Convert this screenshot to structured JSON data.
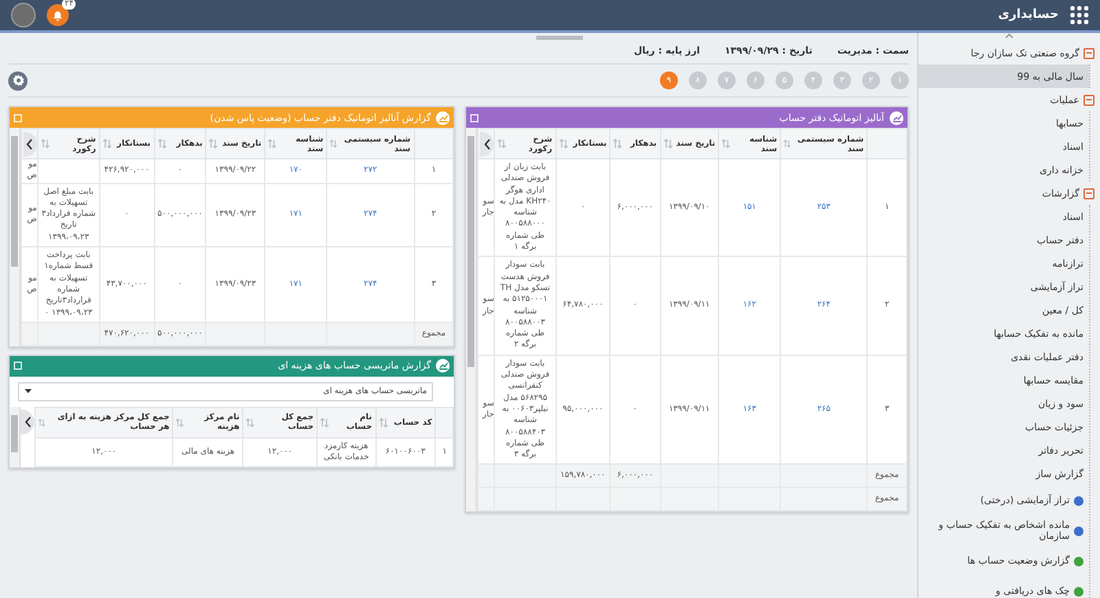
{
  "topbar": {
    "title": "حسابداری",
    "notifications": "۲۴"
  },
  "info": [
    "سمت : مدیریت",
    "تاریخ : ۱۳۹۹/۰۹/۲۹",
    "ارز پایه : ریال"
  ],
  "pager": [
    {
      "label": "۱",
      "selected": false
    },
    {
      "label": "۲",
      "selected": false
    },
    {
      "label": "۳",
      "selected": false
    },
    {
      "label": "۴",
      "selected": false
    },
    {
      "label": "۵",
      "selected": false
    },
    {
      "label": "۶",
      "selected": false
    },
    {
      "label": "۷",
      "selected": false
    },
    {
      "label": "۸",
      "selected": false
    },
    {
      "label": "۹",
      "selected": true
    }
  ],
  "panels": [
    {
      "kind": "ledger",
      "title": "آنالیز اتوماتیک دفتر حساب",
      "color": "#9b6bcc",
      "columns": [
        {
          "label": "شماره سیستمی سند",
          "kind": "link"
        },
        {
          "label": "شناسه سند",
          "kind": "link"
        },
        {
          "label": "تاریخ سند",
          "kind": "text"
        },
        {
          "label": "بدهکار",
          "kind": "text"
        },
        {
          "label": "بستانکار",
          "kind": "text"
        },
        {
          "label": "شرح رکورد",
          "kind": "text"
        }
      ],
      "rows": [
        {
          "index": "۱",
          "cells": [
            "۲۵۳",
            "۱۵۱",
            "۱۳۹۹/۰۹/۱۰",
            "۶,۰۰۰,۰۰۰",
            "۰",
            "بابت زیان از فروش صندلی اداری هوگر KH۲۴۰ مدل به شناسه ۸۰۰۵۸۸۰۰۰ طی شماره برگه ۱"
          ],
          "cut": "سو جار"
        },
        {
          "index": "۲",
          "cells": [
            "۲۶۴",
            "۱۶۲",
            "۱۳۹۹/۰۹/۱۱",
            "۰",
            "۶۴,۷۸۰,۰۰۰",
            "بابت سودار فروش هدست تسکو مدل TH ۵۱۲۵۰۰۰۱ به شناسه ۸۰۰۵۸۸۰۰۳ طی شماره برگه ۲"
          ],
          "cut": "سو جار"
        },
        {
          "index": "۳",
          "cells": [
            "۲۶۵",
            "۱۶۳",
            "۱۳۹۹/۰۹/۱۱",
            "۰",
            "۹۵,۰۰۰,۰۰۰",
            "بابت سودار فروش صندلی کنفرانسی ۵۶۸۲۹۵ مدل نیلپر۰۰۶۰۳ به شناسه ۸۰۰۵۸۸۴۰۳ طی شماره برگه ۳"
          ],
          "cut": "سو جار"
        }
      ],
      "totals": [
        {
          "label": "مجموع",
          "debit": "۶,۰۰۰,۰۰۰",
          "credit": "۱۵۹,۷۸۰,۰۰۰"
        },
        {
          "label": "مجموع"
        }
      ]
    },
    {
      "kind": "ledger",
      "title": "گزارش آنالیز اتوماتیک دفتر حساب (وضعیت پاس شدن)",
      "color": "#f5a32a",
      "columns": [
        {
          "label": "شماره سیستمی سند",
          "kind": "link"
        },
        {
          "label": "شناسه سند",
          "kind": "link"
        },
        {
          "label": "تاریخ سند",
          "kind": "text"
        },
        {
          "label": "بدهکار",
          "kind": "text"
        },
        {
          "label": "بستانکار",
          "kind": "text"
        },
        {
          "label": "شرح رکورد",
          "kind": "text"
        }
      ],
      "rows": [
        {
          "index": "۱",
          "cells": [
            "۲۷۲",
            "۱۷۰",
            "۱۳۹۹/۰۹/۲۲",
            "۰",
            "۴۲۶,۹۲۰,۰۰۰",
            null
          ],
          "cut": "مو ص"
        },
        {
          "index": "۲",
          "cells": [
            "۲۷۴",
            "۱۷۱",
            "۱۳۹۹/۰۹/۲۳",
            "۵۰۰,۰۰۰,۰۰۰",
            "۰",
            "بابت مبلغ اصل تسهیلات به شماره قرارداد۳ تاریخ ۱۳۹۹،۰۹،۲۳"
          ],
          "cut": "مو ص"
        },
        {
          "index": "۳",
          "cells": [
            "۲۷۴",
            "۱۷۱",
            "۱۳۹۹/۰۹/۲۳",
            "۰",
            "۴۳,۷۰۰,۰۰۰",
            "بابت پرداخت قسط شماره۱ تسهیلات به شماره قرارداد۳تاریخ ۱۳۹۹،۰۹،۲۳ ۰"
          ],
          "cut": "مو ص"
        }
      ],
      "totals": [
        {
          "label": "مجموع",
          "debit": "۵۰۰,۰۰۰,۰۰۰",
          "credit": "۴۷۰,۶۲۰,۰۰۰"
        }
      ]
    },
    {
      "kind": "matrix",
      "title": "گزارش ماتریسی حساب های هزینه ای",
      "color": "#23977f",
      "dropdown": {
        "value": "ماتریسی حساب های هزینه ای"
      },
      "columns": [
        {
          "label": "کد حساب",
          "kind": "text"
        },
        {
          "label": "نام حساب",
          "kind": "text"
        },
        {
          "label": "جمع کل حساب",
          "kind": "text"
        },
        {
          "label": "نام مرکز هزینه",
          "kind": "text"
        },
        {
          "label": "جمع کل مرکز هزینه به ازای هر حساب",
          "kind": "text"
        }
      ],
      "rows": [
        {
          "index": "۱",
          "cells": [
            "۶۰۱۰۰۶۰۰۳",
            "هزینه کارمزد خدمات بانکی",
            "۱۲,۰۰۰",
            "هزینه های مالی",
            "۱۲,۰۰۰"
          ]
        }
      ]
    }
  ],
  "sidebar": {
    "tree": [
      {
        "label": "گروه صنعتی تک سازان رجا",
        "kind": "group",
        "expanded": true,
        "selected": false,
        "children": [
          {
            "label": "سال مالی به 99",
            "kind": "item",
            "selected": true
          }
        ]
      },
      {
        "label": "عملیات",
        "kind": "group",
        "expanded": true,
        "selected": false,
        "children": [
          {
            "label": "حسابها",
            "kind": "item",
            "selected": false
          },
          {
            "label": "اسناد",
            "kind": "item",
            "selected": false
          },
          {
            "label": "خزانه داری",
            "kind": "item",
            "selected": false
          }
        ]
      },
      {
        "label": "گزارشات",
        "kind": "group",
        "expanded": true,
        "selected": false,
        "children": [
          {
            "label": "اسناد",
            "kind": "item",
            "selected": false
          },
          {
            "label": "دفتر حساب",
            "kind": "item",
            "selected": false
          },
          {
            "label": "ترازنامه",
            "kind": "item",
            "selected": false
          },
          {
            "label": "تراز آزمایشی",
            "kind": "item",
            "selected": false
          },
          {
            "label": "کل / معین",
            "kind": "item",
            "selected": false
          },
          {
            "label": "مانده به تفکیک حسابها",
            "kind": "item",
            "selected": false
          },
          {
            "label": "دفتر عملیات نقدی",
            "kind": "item",
            "selected": false
          },
          {
            "label": "مقایسه حسابها",
            "kind": "item",
            "selected": false
          },
          {
            "label": "سود و زیان",
            "kind": "item",
            "selected": false
          },
          {
            "label": "جزئیات حساب",
            "kind": "item",
            "selected": false
          },
          {
            "label": "تحریر دفاتر",
            "kind": "item",
            "selected": false
          },
          {
            "label": "گزارش ساز",
            "kind": "item",
            "selected": false
          },
          {
            "label": "تراز آزمایشی (درختی)",
            "kind": "report",
            "color": "#3b6fc9",
            "selected": false
          },
          {
            "label": "مانده اشخاص به تفکیک حساب و سازمان",
            "kind": "report",
            "color": "#3b6fc9",
            "selected": false
          },
          {
            "label": "گزارش وضعیت حساب ها",
            "kind": "report",
            "color": "#3ea33e",
            "selected": false
          },
          {
            "label": "چک های دریافتی و",
            "kind": "report",
            "color": "#3ea33e",
            "selected": false
          }
        ]
      }
    ]
  }
}
